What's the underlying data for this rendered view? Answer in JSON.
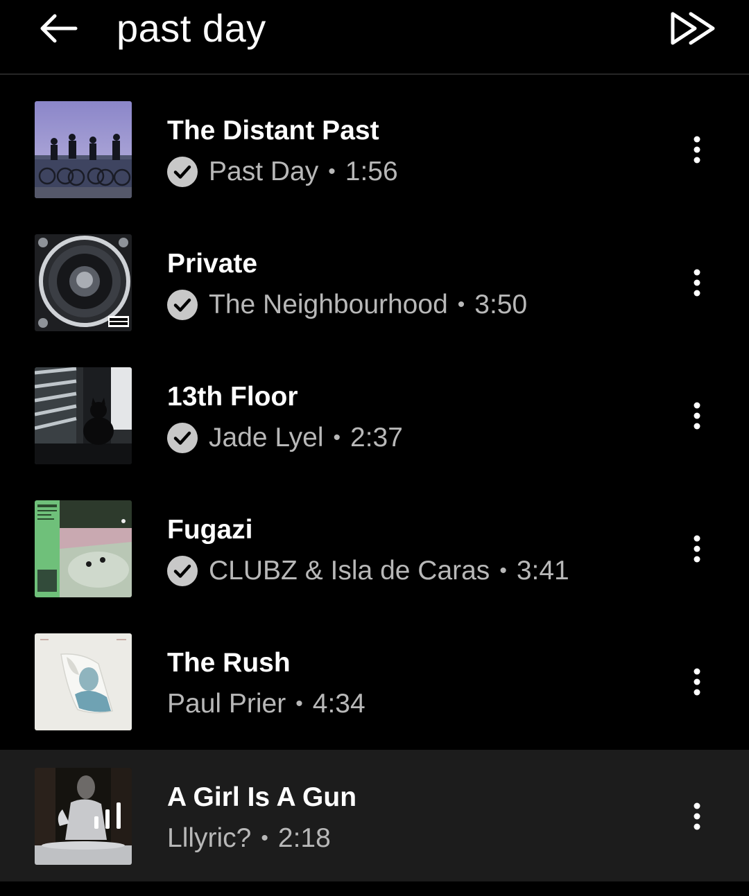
{
  "header": {
    "back_icon": "arrow-left-icon",
    "title": "past day",
    "play_all_icon": "play-next-double-arrow-icon"
  },
  "tracks": [
    {
      "title": "The Distant Past",
      "artist": "Past Day",
      "duration": "1:56",
      "downloaded": true,
      "playing": false,
      "more_icon": "more-vertical-icon"
    },
    {
      "title": "Private",
      "artist": "The Neighbourhood",
      "duration": "3:50",
      "downloaded": true,
      "playing": false,
      "more_icon": "more-vertical-icon"
    },
    {
      "title": "13th Floor",
      "artist": "Jade Lyel",
      "duration": "2:37",
      "downloaded": true,
      "playing": false,
      "more_icon": "more-vertical-icon"
    },
    {
      "title": "Fugazi",
      "artist": "CLUBZ & Isla de Caras",
      "duration": "3:41",
      "downloaded": true,
      "playing": false,
      "more_icon": "more-vertical-icon"
    },
    {
      "title": "The Rush",
      "artist": "Paul Prier",
      "duration": "4:34",
      "downloaded": false,
      "playing": false,
      "more_icon": "more-vertical-icon"
    },
    {
      "title": "A Girl Is A Gun",
      "artist": "Lllyric?",
      "duration": "2:18",
      "downloaded": false,
      "playing": true,
      "more_icon": "more-vertical-icon"
    }
  ],
  "separator": "•",
  "colors": {
    "background": "#000000",
    "playing_row": "#1c1c1c",
    "subtitle": "#b8b8b8",
    "icon_badge": "#c8c8c8"
  }
}
